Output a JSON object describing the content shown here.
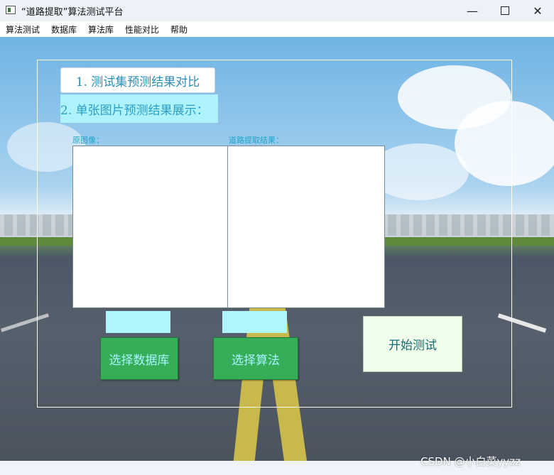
{
  "window": {
    "title": "“道路提取”算法测试平台",
    "icons": {
      "minimize": "minimize-icon",
      "maximize": "maximize-icon",
      "close": "close-icon"
    }
  },
  "menu": [
    "算法测试",
    "数据库",
    "算法库",
    "性能对比",
    "帮助"
  ],
  "panel": {
    "tab1": "1. 测试集预测结果对比",
    "tab2": "2. 单张图片预测结果展示：",
    "original_label": "原图像：",
    "result_label": "道路提取结果：",
    "select_db_button": "选择数据库",
    "select_algo_button": "选择算法",
    "start_button": "开始测试"
  },
  "colors": {
    "accent_cyan": "#aef6fc",
    "button_green": "#36ad57",
    "start_bg": "#eefeea"
  },
  "watermark": "CSDN @小白菜yyzz"
}
